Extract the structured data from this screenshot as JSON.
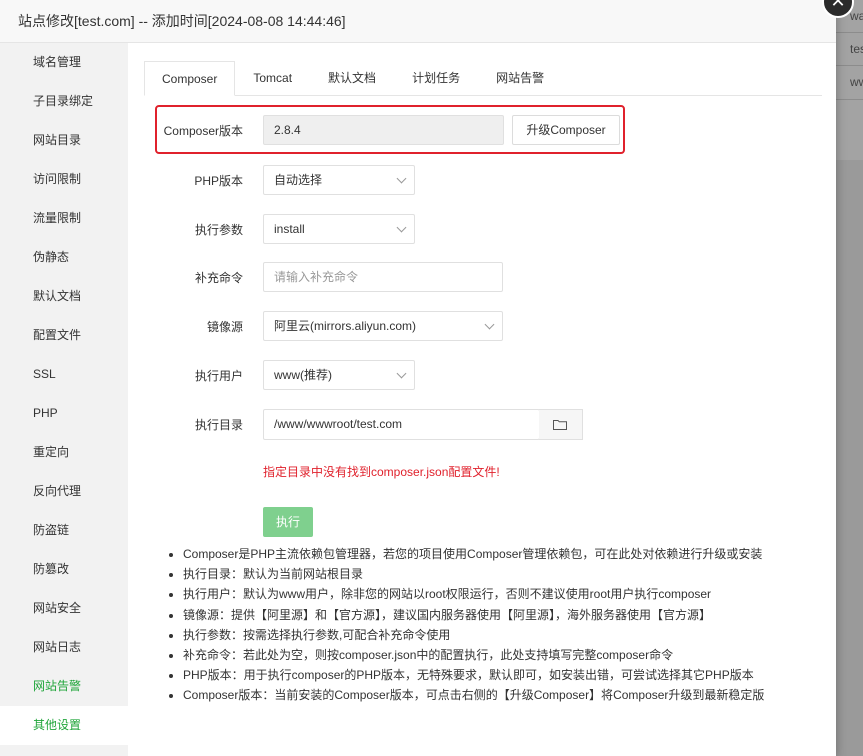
{
  "dialog": {
    "title": "站点修改[test.com] -- 添加时间[2024-08-08 14:44:46]",
    "close_icon": "close-icon"
  },
  "background_page": {
    "cells": [
      "wa",
      "tes",
      "ww"
    ]
  },
  "sidebar": {
    "items": [
      {
        "label": "域名管理"
      },
      {
        "label": "子目录绑定"
      },
      {
        "label": "网站目录"
      },
      {
        "label": "访问限制"
      },
      {
        "label": "流量限制"
      },
      {
        "label": "伪静态"
      },
      {
        "label": "默认文档"
      },
      {
        "label": "配置文件"
      },
      {
        "label": "SSL"
      },
      {
        "label": "PHP"
      },
      {
        "label": "重定向"
      },
      {
        "label": "反向代理"
      },
      {
        "label": "防盗链"
      },
      {
        "label": "防篡改"
      },
      {
        "label": "网站安全"
      },
      {
        "label": "网站日志"
      },
      {
        "label": "网站告警"
      },
      {
        "label": "其他设置"
      }
    ],
    "active_index": 17,
    "accent_color": "#20a53a"
  },
  "tabs": [
    {
      "label": "Composer"
    },
    {
      "label": "Tomcat"
    },
    {
      "label": "默认文档"
    },
    {
      "label": "计划任务"
    },
    {
      "label": "网站告警"
    }
  ],
  "form": {
    "composer_version": {
      "label": "Composer版本",
      "value": "2.8.4",
      "button": "升级Composer"
    },
    "php_version": {
      "label": "PHP版本",
      "value": "自动选择"
    },
    "exec_params": {
      "label": "执行参数",
      "value": "install"
    },
    "extra_cmd": {
      "label": "补充命令",
      "placeholder": "请输入补充命令"
    },
    "mirror": {
      "label": "镜像源",
      "value": "阿里云(mirrors.aliyun.com)"
    },
    "exec_user": {
      "label": "执行用户",
      "value": "www(推荐)"
    },
    "exec_dir": {
      "label": "执行目录",
      "value": "/www/wwwroot/test.com",
      "icon": "folder-icon"
    },
    "warning": "指定目录中没有找到composer.json配置文件!",
    "exec_button": "执行"
  },
  "tips": [
    "Composer是PHP主流依赖包管理器，若您的项目使用Composer管理依赖包，可在此处对依赖进行升级或安装",
    "执行目录：默认为当前网站根目录",
    "执行用户：默认为www用户，除非您的网站以root权限运行，否则不建议使用root用户执行composer",
    "镜像源：提供【阿里源】和【官方源】，建议国内服务器使用【阿里源】，海外服务器使用【官方源】",
    "执行参数：按需选择执行参数,可配合补充命令使用",
    "补充命令：若此处为空，则按composer.json中的配置执行，此处支持填写完整composer命令",
    "PHP版本：用于执行composer的PHP版本，无特殊要求，默认即可，如安装出错，可尝试选择其它PHP版本",
    "Composer版本：当前安装的Composer版本，可点击右侧的【升级Composer】将Composer升级到最新稳定版"
  ]
}
